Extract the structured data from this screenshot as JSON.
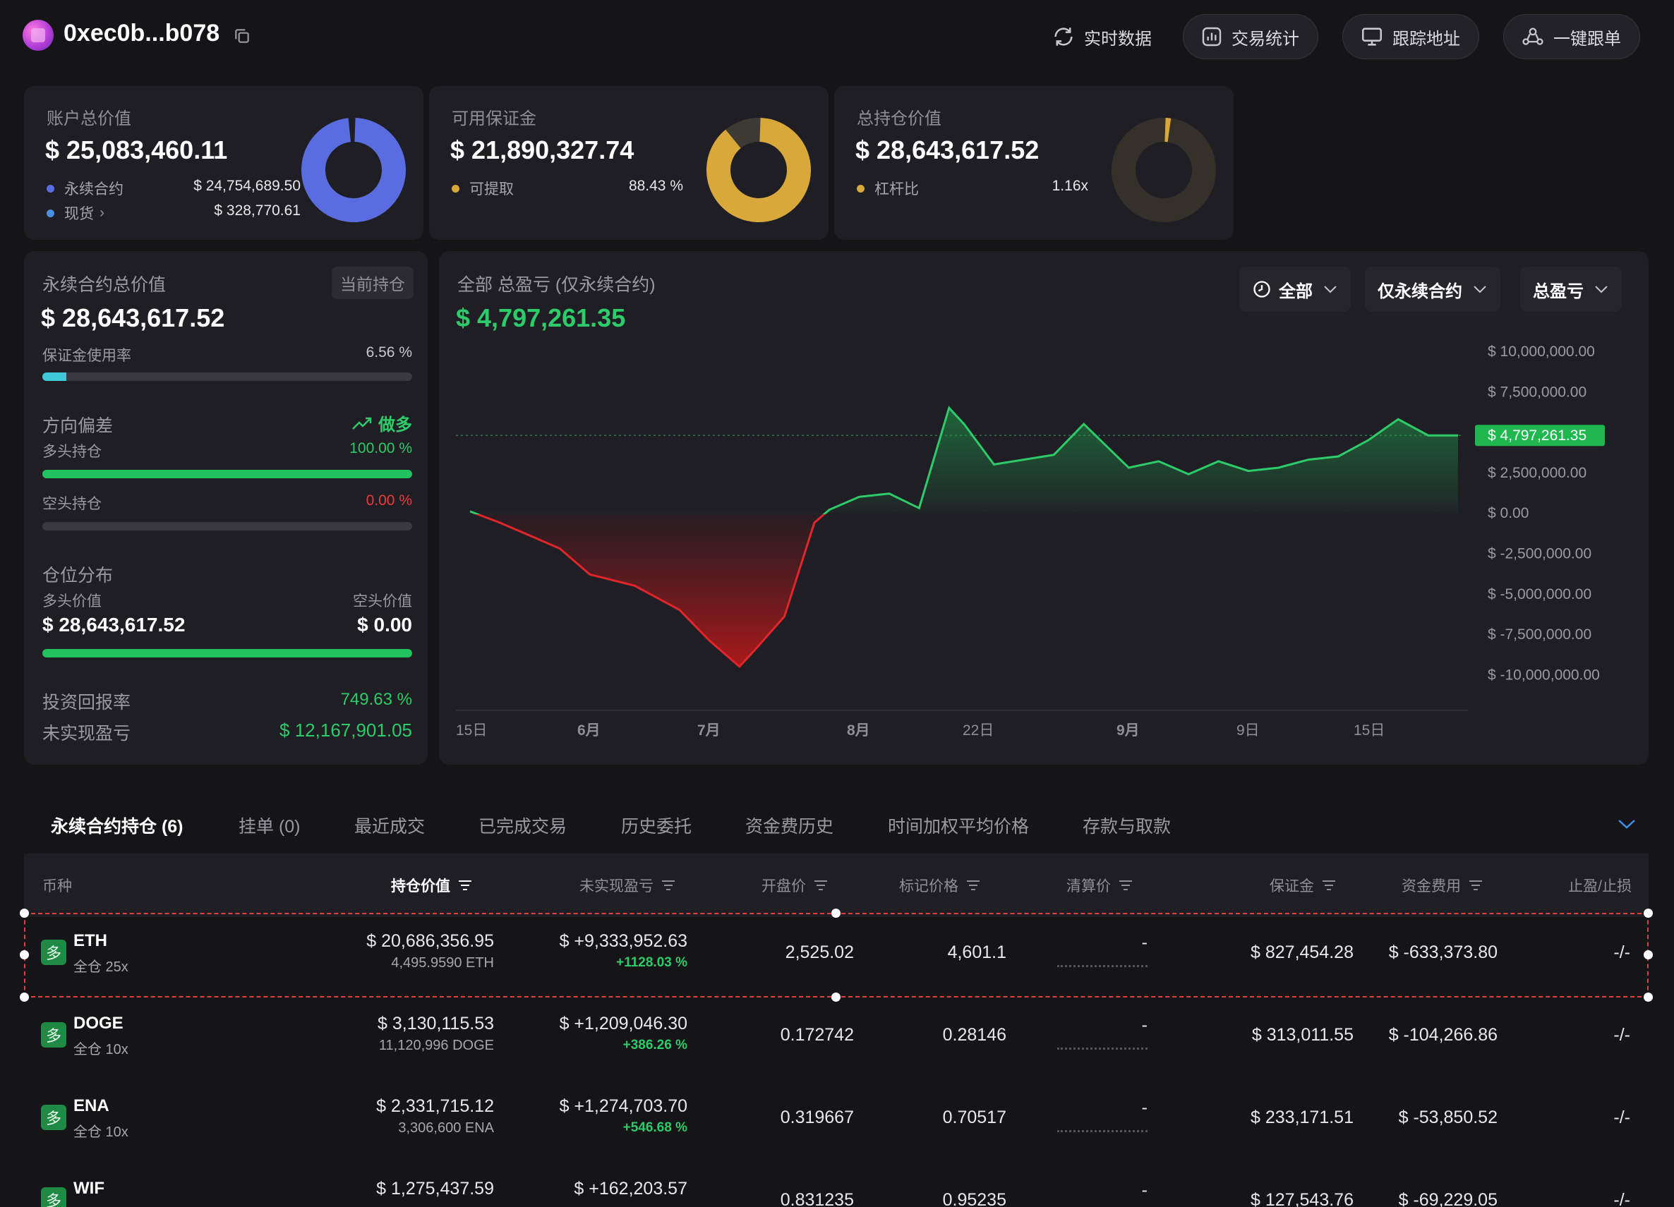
{
  "header": {
    "address": "0xec0b...b078",
    "buttons": [
      {
        "label": "实时数据",
        "icon": "refresh-icon"
      },
      {
        "label": "交易统计",
        "icon": "stats-icon"
      },
      {
        "label": "跟踪地址",
        "icon": "monitor-icon"
      },
      {
        "label": "一键跟单",
        "icon": "follow-icon"
      }
    ]
  },
  "stats": {
    "account": {
      "title": "账户总价值",
      "value": "$ 25,083,460.11",
      "perp_label": "永续合约",
      "perp_value": "$ 24,754,689.50",
      "spot_label": "现货",
      "spot_value": "$ 328,770.61",
      "perp_color": "#5a6de0",
      "spot_color": "#4a8fe0"
    },
    "margin": {
      "title": "可用保证金",
      "value": "$ 21,890,327.74",
      "withdraw_label": "可提取",
      "withdraw_value": "88.43 %",
      "withdraw_fraction": 0.8843,
      "color": "#d8a93a"
    },
    "position": {
      "title": "总持仓价值",
      "value": "$ 28,643,617.52",
      "leverage_label": "杠杆比",
      "leverage_value": "1.16x",
      "color": "#d8a93a"
    }
  },
  "perp_panel": {
    "title": "永续合约总价值",
    "chip": "当前持仓",
    "value": "$ 28,643,617.52",
    "margin_usage_label": "保证金使用率",
    "margin_usage_value": "6.56 %",
    "margin_usage_fraction": 0.0656,
    "direction_label": "方向偏差",
    "direction_value": "做多",
    "long_label": "多头持仓",
    "long_value": "100.00 %",
    "long_fraction": 1.0,
    "short_label": "空头持仓",
    "short_value": "0.00 %",
    "short_fraction": 0.0,
    "dist_label": "仓位分布",
    "long_value_label": "多头价值",
    "short_value_label": "空头价值",
    "long_amount": "$ 28,643,617.52",
    "short_amount": "$ 0.00",
    "roi_label": "投资回报率",
    "roi_value": "749.63 %",
    "upnl_label": "未实现盈亏",
    "upnl_value": "$ 12,167,901.05"
  },
  "pnl_panel": {
    "title": "全部 总盈亏 (仅永续合约)",
    "value": "$ 4,797,261.35",
    "filters": [
      "全部",
      "仅永续合约",
      "总盈亏"
    ],
    "current_label": "$ 4,797,261.35"
  },
  "chart_data": {
    "type": "area",
    "title": "",
    "ylim": [
      -10000000,
      10000000
    ],
    "y_ticks": [
      "$ 10,000,000.00",
      "$ 7,500,000.00",
      "$ 5,000,000.00",
      "$ 2,500,000.00",
      "$ 0.00",
      "$ -2,500,000.00",
      "$ -5,000,000.00",
      "$ -7,500,000.00",
      "$ -10,000,000.00"
    ],
    "x_ticks": [
      "15日",
      "6月",
      "7月",
      "8月",
      "22日",
      "9月",
      "9日",
      "15日"
    ],
    "x": [
      0,
      2,
      6,
      8,
      11,
      14,
      16,
      18,
      19,
      21,
      23,
      24,
      26,
      28,
      30,
      32,
      33,
      35,
      39,
      41,
      44,
      46,
      48,
      50,
      52,
      54,
      56,
      58,
      60,
      62,
      64,
      66
    ],
    "values": [
      100000,
      -600000,
      -2200000,
      -3800000,
      -4500000,
      -6000000,
      -7900000,
      -9500000,
      -8500000,
      -6400000,
      -600000,
      200000,
      1000000,
      1200000,
      300000,
      6500000,
      5500000,
      3000000,
      3600000,
      5500000,
      2800000,
      3200000,
      2400000,
      3200000,
      2600000,
      2800000,
      3300000,
      3500000,
      4500000,
      5800000,
      4800000,
      4797261
    ],
    "current": 4797261.35
  },
  "tabs": [
    "永续合约持仓 (6)",
    "挂单 (0)",
    "最近成交",
    "已完成交易",
    "历史委托",
    "资金费历史",
    "时间加权平均价格",
    "存款与取款"
  ],
  "table": {
    "headers": [
      "币种",
      "持仓价值",
      "未实现盈亏",
      "开盘价",
      "标记价格",
      "清算价",
      "保证金",
      "资金费用",
      "止盈/止损"
    ],
    "rows": [
      {
        "tag": "多",
        "coin": "ETH",
        "mode": "全仓 25x",
        "value": "$ 20,686,356.95",
        "size": "4,495.9590 ETH",
        "pnl": "$ +9,333,952.63",
        "pnl_pct": "+1128.03 %",
        "entry": "2,525.02",
        "mark": "4,601.1",
        "liq": "-",
        "margin": "$ 827,454.28",
        "funding": "$ -633,373.80",
        "tpsl": "-/-"
      },
      {
        "tag": "多",
        "coin": "DOGE",
        "mode": "全仓 10x",
        "value": "$ 3,130,115.53",
        "size": "11,120,996 DOGE",
        "pnl": "$ +1,209,046.30",
        "pnl_pct": "+386.26 %",
        "entry": "0.172742",
        "mark": "0.28146",
        "liq": "-",
        "margin": "$ 313,011.55",
        "funding": "$ -104,266.86",
        "tpsl": "-/-"
      },
      {
        "tag": "多",
        "coin": "ENA",
        "mode": "全仓 10x",
        "value": "$ 2,331,715.12",
        "size": "3,306,600 ENA",
        "pnl": "$ +1,274,703.70",
        "pnl_pct": "+546.68 %",
        "entry": "0.319667",
        "mark": "0.70517",
        "liq": "-",
        "margin": "$ 233,171.51",
        "funding": "$ -53,850.52",
        "tpsl": "-/-"
      },
      {
        "tag": "多",
        "coin": "WIF",
        "mode": "",
        "value": "$ 1,275,437.59",
        "size": "",
        "pnl": "$ +162,203.57",
        "pnl_pct": "",
        "entry": "0.831235",
        "mark": "0.95235",
        "liq": "-",
        "margin": "$ 127,543.76",
        "funding": "$ -69,229.05",
        "tpsl": "-/-"
      }
    ]
  }
}
